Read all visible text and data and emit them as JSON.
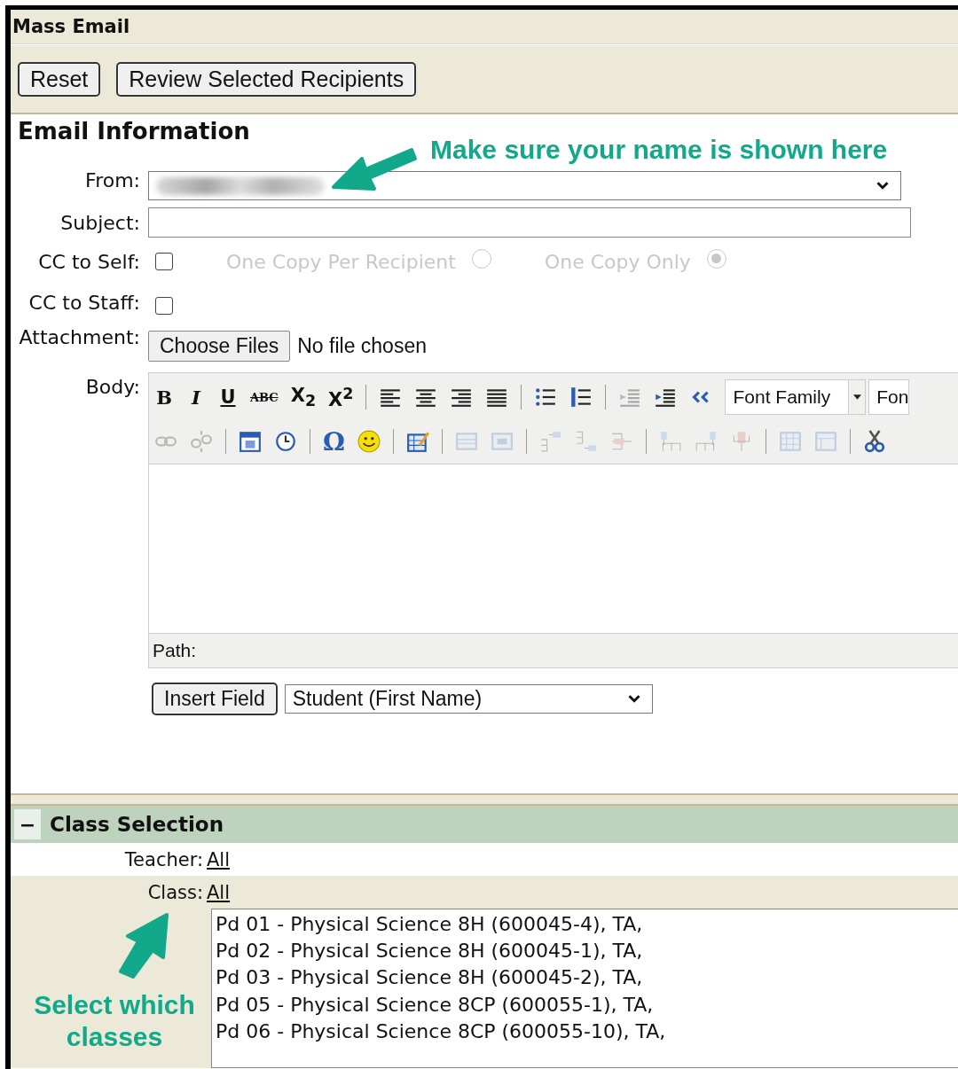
{
  "title": "Mass Email",
  "actions": [
    "Reset",
    "Review Selected Recipients"
  ],
  "email_info": {
    "heading": "Email Information",
    "from": {
      "label": "From:"
    },
    "subject": {
      "label": "Subject:"
    },
    "cc_self": {
      "label": "CC to Self:",
      "checked": false
    },
    "copy_options": [
      {
        "label": "One Copy Per Recipient",
        "selected": false,
        "disabled": true
      },
      {
        "label": "One Copy Only",
        "selected": true,
        "disabled": true
      }
    ],
    "cc_staff": {
      "label": "CC to Staff:",
      "checked": false
    },
    "attachment": {
      "label": "Attachment:",
      "button": "Choose Files",
      "status": "No file chosen"
    },
    "body": {
      "label": "Body:",
      "path_label": "Path:",
      "toolbar": [
        [
          {
            "kind": "bold",
            "label": "B"
          },
          {
            "kind": "italic",
            "label": "I"
          },
          {
            "kind": "underline",
            "label": "U"
          },
          {
            "kind": "strike",
            "label": "ABC"
          },
          {
            "kind": "subscript",
            "label": "X$_{2}$"
          },
          {
            "kind": "superscript",
            "label": "X$^{2}$"
          },
          {
            "kind": "sep"
          },
          {
            "kind": "align-left",
            "disabled": false
          },
          {
            "kind": "align-center",
            "disabled": false
          },
          {
            "kind": "align-right",
            "disabled": false
          },
          {
            "kind": "justify",
            "disabled": false
          },
          {
            "kind": "sep"
          },
          {
            "kind": "bullet-list",
            "disabled": false
          },
          {
            "kind": "numbered-list",
            "disabled": false
          },
          {
            "kind": "sep"
          },
          {
            "kind": "outdent",
            "disabled": true
          },
          {
            "kind": "indent",
            "disabled": false
          },
          {
            "kind": "quote",
            "disabled": false
          },
          {
            "kind": "select",
            "label": "Font Family"
          },
          {
            "kind": "select",
            "label": "Fon"
          }
        ],
        [
          {
            "kind": "link",
            "disabled": true
          },
          {
            "kind": "unlink",
            "disabled": true
          },
          {
            "kind": "sep"
          },
          {
            "kind": "calendar",
            "disabled": false
          },
          {
            "kind": "clock",
            "disabled": false
          },
          {
            "kind": "sep"
          },
          {
            "kind": "char",
            "label": "Ω"
          },
          {
            "kind": "smiley",
            "disabled": false
          },
          {
            "kind": "sep"
          },
          {
            "kind": "table-edit",
            "disabled": false
          },
          {
            "kind": "sep"
          },
          {
            "kind": "table-row",
            "disabled": true
          },
          {
            "kind": "table-cell",
            "disabled": true
          },
          {
            "kind": "sep"
          },
          {
            "kind": "row-before",
            "disabled": true
          },
          {
            "kind": "row-after",
            "disabled": true
          },
          {
            "kind": "row-delete",
            "disabled": true
          },
          {
            "kind": "sep"
          },
          {
            "kind": "column-before",
            "disabled": true
          },
          {
            "kind": "column-after",
            "disabled": true
          },
          {
            "kind": "column-delete",
            "disabled": true
          },
          {
            "kind": "sep"
          },
          {
            "kind": "split-cells",
            "disabled": true
          },
          {
            "kind": "merge-cells",
            "disabled": true
          },
          {
            "kind": "sep"
          },
          {
            "kind": "scissors",
            "disabled": false
          }
        ]
      ]
    },
    "insert_field": {
      "button": "Insert Field",
      "value": "Student (First Name)"
    }
  },
  "class_selection": {
    "toggle": "−",
    "heading": "Class Selection",
    "teacher": {
      "label": "Teacher:",
      "link": "All"
    },
    "class": {
      "label": "Class:",
      "link": "All"
    },
    "classes": [
      "Pd 01 - Physical Science 8H (600045-4), TA,",
      "Pd 02 - Physical Science 8H (600045-1), TA,",
      "Pd 03 - Physical Science 8H (600045-2), TA,",
      "Pd 05 - Physical Science 8CP (600055-1), TA,",
      "Pd 06 - Physical Science 8CP (600055-10), TA,"
    ]
  },
  "annotations": [
    {
      "text": "Make sure your name is shown here"
    },
    {
      "text": "Select which classes"
    }
  ]
}
